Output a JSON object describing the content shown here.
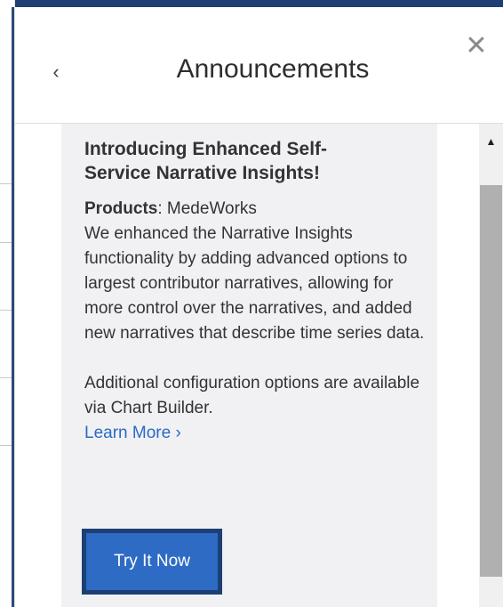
{
  "panel": {
    "title": "Announcements",
    "back_icon": "chevron-left-icon",
    "close_icon": "close-icon",
    "back_glyph": "‹",
    "close_glyph": "✕"
  },
  "announcement": {
    "title_line1": "Introducing Enhanced Self-",
    "title_line2": "Service Narrative Insights!",
    "products_label": "Products",
    "products_value": ": MedeWorks",
    "description": "We enhanced the Narrative Insights functionality by adding advanced options to largest contributor narratives, allowing for more control over the narratives, and added new narratives that describe time series data.",
    "additional": "Additional configuration options are available via Chart Builder.",
    "learn_more": "Learn More ›",
    "cta_label": "Try It Now"
  },
  "scrollbar": {
    "up_glyph": "▲"
  },
  "colors": {
    "accent_dark": "#1d3f73",
    "button_blue": "#2e6bc4",
    "link_blue": "#2a6ac4",
    "card_bg": "#f1f1f4"
  }
}
